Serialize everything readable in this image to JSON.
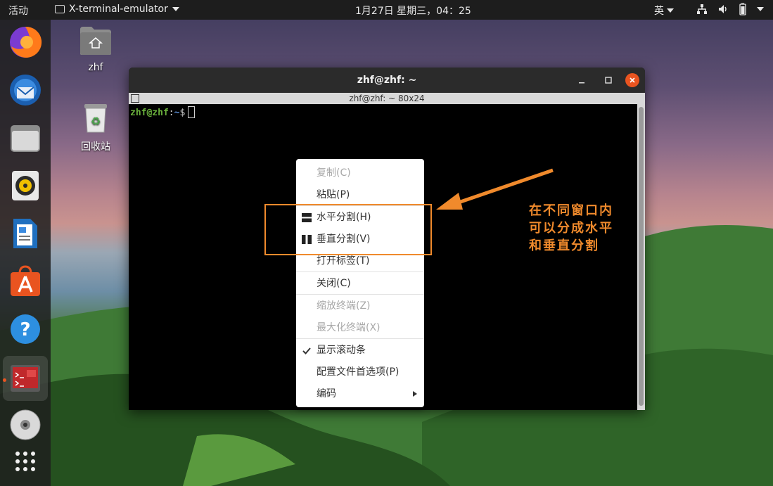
{
  "topbar": {
    "activities": "活动",
    "app_name": "X-terminal-emulator",
    "clock": "1月27日 星期三，04：25",
    "ime": "英"
  },
  "desktop": {
    "home_label": "zhf",
    "trash_label": "回收站"
  },
  "terminal": {
    "title": "zhf@zhf: ~",
    "subtitle": "zhf@zhf: ~ 80x24",
    "prompt_user": "zhf@zhf",
    "prompt_colon": ":",
    "prompt_path": "~",
    "prompt_symbol": "$"
  },
  "context_menu": {
    "copy": "复制(C)",
    "paste": "粘贴(P)",
    "split_horizontal": "水平分割(H)",
    "split_vertical": "垂直分割(V)",
    "open_tab": "打开标签(T)",
    "close": "关闭(C)",
    "zoom_terminal": "缩放终端(Z)",
    "maximize_terminal": "最大化终端(X)",
    "show_scrollbar": "显示滚动条",
    "preferences": "配置文件首选项(P)",
    "encoding": "编码"
  },
  "annotation": {
    "line1": "在不同窗口内",
    "line2": "可以分成水平",
    "line3": "和垂直分割",
    "color": "#f08a2c"
  },
  "colors": {
    "accent": "#e95420",
    "prompt_green": "#6ab13c",
    "prompt_blue": "#5c8fd6"
  }
}
